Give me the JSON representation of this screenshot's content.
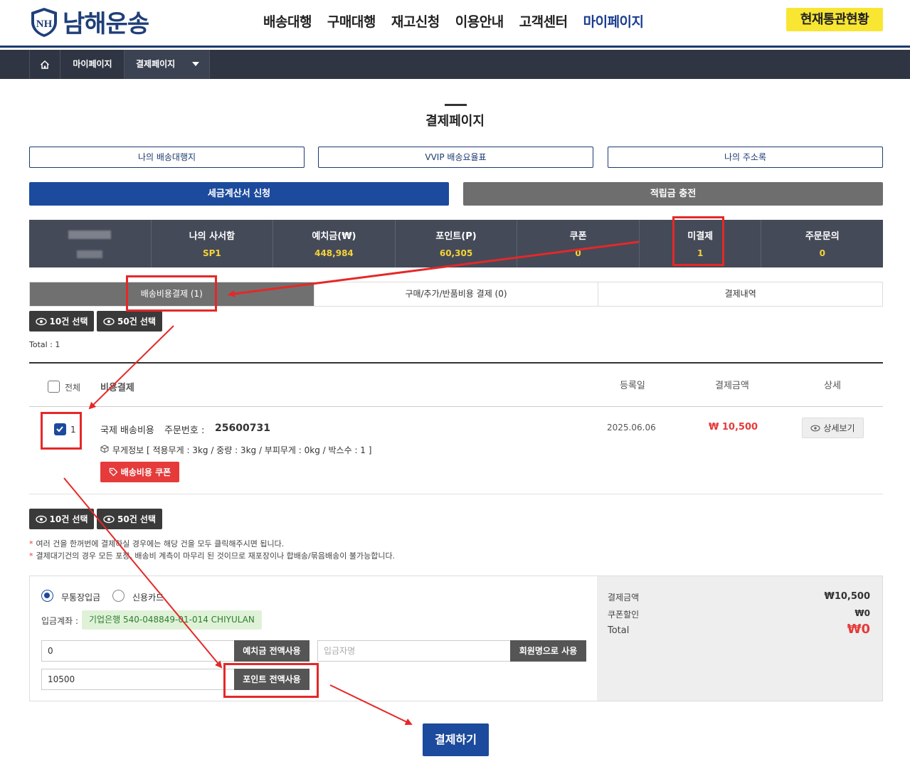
{
  "header": {
    "logo_text": "남해운송",
    "logo_mark": "NH",
    "nav": [
      "배송대행",
      "구매대행",
      "재고신청",
      "이용안내",
      "고객센터",
      "마이페이지"
    ],
    "customs_button": "현재통관현황"
  },
  "breadcrumb": {
    "home_icon": "home-icon",
    "mypage": "마이페이지",
    "current": "결제페이지"
  },
  "page_title": "결제페이지",
  "links": {
    "delivery_list": "나의 배송대행지",
    "vvip_rates": "VVIP 배송요율표",
    "address_book": "나의 주소록"
  },
  "actions": {
    "tax_invoice": "세금계산서 신청",
    "charge_points": "적립금 충전"
  },
  "stats": [
    {
      "label": "나의 사서함",
      "value": "SP1"
    },
    {
      "label": "예치금(₩)",
      "value": "448,984"
    },
    {
      "label": "포인트(P)",
      "value": "60,305"
    },
    {
      "label": "쿠폰",
      "value": "0"
    },
    {
      "label": "미결제",
      "value": "1"
    },
    {
      "label": "주문문의",
      "value": "0"
    }
  ],
  "tabs": [
    "배송비용결제 (1)",
    "구매/추가/반품비용 결제 (0)",
    "결제내역"
  ],
  "select_buttons": {
    "ten": "10건 선택",
    "fifty": "50건 선택"
  },
  "total": "Total : 1",
  "table": {
    "headers": {
      "all": "전체",
      "item": "비용결제",
      "date": "등록일",
      "amount": "결제금액",
      "detail": "상세"
    },
    "rows": [
      {
        "no": "1",
        "type": "국제 배송비용",
        "order_label": "주문번호 :",
        "order_no": "25600731",
        "weight_info": "무게정보 [ 적용무게 : 3kg / 중량 : 3kg / 부피무게 : 0kg / 박스수 : 1 ]",
        "coupon_button": "배송비용 쿠폰",
        "date": "2025.06.06",
        "amount": "₩ 10,500",
        "detail_button": "상세보기"
      }
    ]
  },
  "notes": [
    "여러 건을 한꺼번에 결제하실 경우에는 해당 건을 모두 클릭해주시면 됩니다.",
    "결제대기건의 경우 모든 포장, 배송비 계측이 마무리 된 것이므로 재포장이나 합배송/묶음배송이 불가능합니다."
  ],
  "payment": {
    "method_bank": "무통장입금",
    "method_card": "신용카드",
    "account_label": "입금계좌 :",
    "account_value": "기업은행 540-048849-01-014 CHIYULAN",
    "deposit_input": "0",
    "deposit_button": "예치금 전액사용",
    "depositor_placeholder": "입금자명",
    "member_name_button": "회원명으로 사용",
    "point_input": "10500",
    "point_button": "포인트 전액사용",
    "summary": {
      "amount_label": "결제금액",
      "amount_value": "₩10,500",
      "coupon_label": "쿠폰할인",
      "coupon_value": "₩0",
      "total_label": "Total",
      "total_value": "₩0"
    },
    "submit": "결제하기"
  },
  "colors": {
    "brand_navy": "#1c4a9c",
    "accent_yellow": "#f8e633",
    "alert_red": "#e53b3b",
    "annotation_red": "#e52828"
  }
}
